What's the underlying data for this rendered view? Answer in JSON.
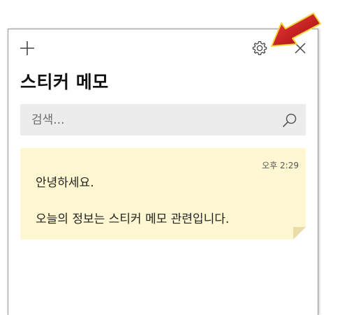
{
  "app": {
    "title": "스티커 메모"
  },
  "titlebar": {
    "add_icon": "plus-icon",
    "settings_icon": "gear-icon",
    "close_icon": "close-icon"
  },
  "search": {
    "placeholder": "검색...",
    "icon": "search-icon"
  },
  "notes": [
    {
      "time": "오후 2:29",
      "lines": [
        "안녕하세요.",
        "오늘의 정보는 스티커 메모 관련입니다."
      ],
      "color": "#fff7d1"
    }
  ],
  "annotation": {
    "arrow_color": "#cc1111",
    "points_to": "gear-icon"
  }
}
